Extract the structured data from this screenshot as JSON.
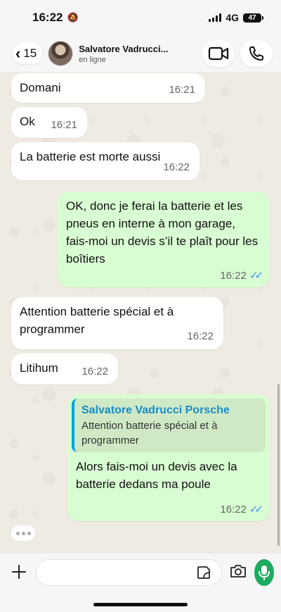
{
  "status_bar": {
    "time": "16:22",
    "network": "4G",
    "battery": "47"
  },
  "header": {
    "back_count": "15",
    "contact_name": "Salvatore Vadrucci...",
    "contact_status": "en ligne"
  },
  "messages": [
    {
      "direction": "in",
      "text": "Domani",
      "time": "16:21"
    },
    {
      "direction": "in",
      "text": "Ok",
      "time": "16:21"
    },
    {
      "direction": "in",
      "text": "La batterie est morte aussi",
      "time": "16:22"
    },
    {
      "direction": "out",
      "text": "OK, donc je ferai la batterie et les pneus en interne à mon garage, fais-moi un devis s’il te plaît pour les boîtiers",
      "time": "16:22",
      "status": "read"
    },
    {
      "direction": "in",
      "text": "Attention batterie spécial et à programmer",
      "time": "16:22"
    },
    {
      "direction": "in",
      "text": "Litihum",
      "time": "16:22"
    },
    {
      "direction": "out",
      "quote_author": "Salvatore Vadrucci Porsche",
      "quote_text": "Attention batterie spécial et à programmer",
      "text": "Alors fais-moi un devis avec la batterie dedans ma poule",
      "time": "16:22",
      "status": "read"
    }
  ],
  "composer": {
    "placeholder": ""
  },
  "icons": {
    "back": "chevron-left-icon",
    "video": "video-call-icon",
    "phone": "phone-icon",
    "plus": "plus-icon",
    "sticker": "sticker-icon",
    "camera": "camera-icon",
    "mic": "microphone-icon",
    "ticks": "double-check-icon"
  },
  "colors": {
    "incoming_bubble": "#ffffff",
    "outgoing_bubble": "#d9fdd3",
    "read_ticks": "#3497f9",
    "quote_author": "#1a8cc7",
    "mic_button": "#1daa61"
  }
}
